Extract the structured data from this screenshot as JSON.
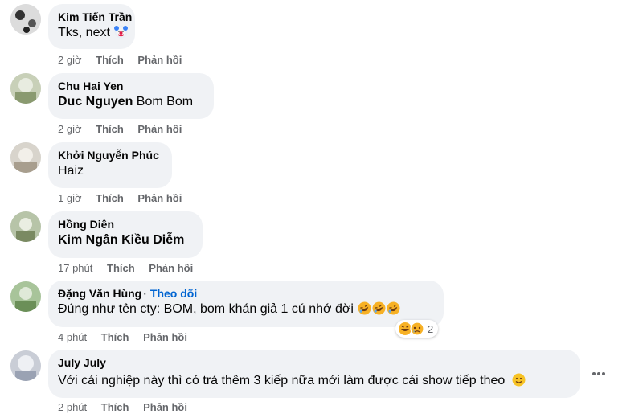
{
  "comments": [
    {
      "author": "Kim Tiến Trần",
      "text": "Tks, next",
      "time": "2 giờ",
      "like": "Thích",
      "reply": "Phản hồi",
      "emoji": "clown-face"
    },
    {
      "author": "Chu Hai Yen",
      "mention": "Duc Nguyen",
      "text": "Bom Bom",
      "time": "2 giờ",
      "like": "Thích",
      "reply": "Phản hồi"
    },
    {
      "author": "Khởi Nguyễn Phúc",
      "text": "Haiz",
      "time": "1 giờ",
      "like": "Thích",
      "reply": "Phản hồi"
    },
    {
      "author": "Hồng Diên",
      "mention": "Kim Ngân Kiều Diễm",
      "time": "17 phút",
      "like": "Thích",
      "reply": "Phản hồi"
    },
    {
      "author": "Đặng Văn Hùng",
      "follow": "Theo dõi",
      "text": "Đúng như tên cty: BOM, bom khán giả 1 cú nhớ đời",
      "emojis": [
        "rolling-laughing",
        "rolling-laughing",
        "rolling-laughing"
      ],
      "reactions": [
        "haha",
        "sad"
      ],
      "reaction_count": "2",
      "time": "4 phút",
      "like": "Thích",
      "reply": "Phản hồi"
    },
    {
      "author": "July July",
      "text": "Với cái nghiệp này thì có trả thêm 3 kiếp nữa mới làm được cái show tiếp theo",
      "emoji": "slightly-smiling",
      "time": "2 phút",
      "like": "Thích",
      "reply": "Phản hồi",
      "more_icon": "more-horizontal-icon"
    }
  ]
}
